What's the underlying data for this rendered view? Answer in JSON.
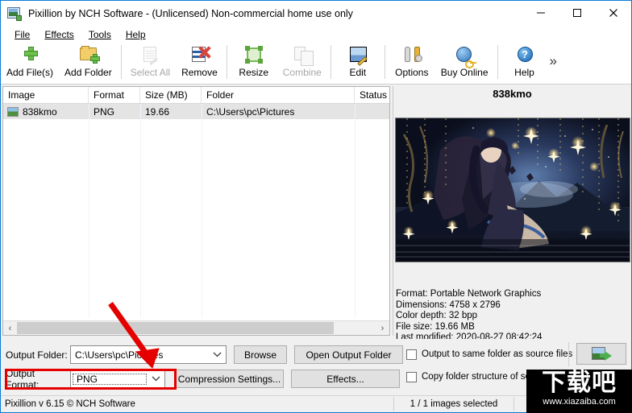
{
  "window": {
    "title": "Pixillion by NCH Software - (Unlicensed) Non-commercial home use only",
    "app_icon": "image-app-icon",
    "minimize": "–",
    "maximize": "□",
    "close": "✕"
  },
  "menu": [
    {
      "label": "File"
    },
    {
      "label": "Effects"
    },
    {
      "label": "Tools"
    },
    {
      "label": "Help"
    }
  ],
  "toolbar": {
    "items": [
      {
        "label": "Add File(s)",
        "icon": "green-plus-icon",
        "enabled": true
      },
      {
        "label": "Add Folder",
        "icon": "folder-plus-icon",
        "enabled": true
      },
      {
        "label": "Select All",
        "icon": "select-all-icon",
        "enabled": false
      },
      {
        "label": "Remove",
        "icon": "remove-red-x-icon",
        "enabled": true
      },
      {
        "label": "Resize",
        "icon": "resize-icon",
        "enabled": true
      },
      {
        "label": "Combine",
        "icon": "combine-icon",
        "enabled": false
      },
      {
        "label": "Edit",
        "icon": "edit-image-icon",
        "enabled": true
      },
      {
        "label": "Options",
        "icon": "wrench-screwdriver-icon",
        "enabled": true
      },
      {
        "label": "Buy Online",
        "icon": "globe-key-icon",
        "enabled": true
      },
      {
        "label": "Help",
        "icon": "help-question-icon",
        "enabled": true
      }
    ],
    "overflow": "»"
  },
  "file_list": {
    "columns": [
      "Image",
      "Format",
      "Size (MB)",
      "Folder",
      "Status"
    ],
    "rows": [
      {
        "image": "838kmo",
        "format": "PNG",
        "size": "19.66",
        "folder": "C:\\Users\\pc\\Pictures",
        "status": ""
      }
    ],
    "scroll_left_arrow": "‹",
    "scroll_right_arrow": "›"
  },
  "preview": {
    "title": "838kmo",
    "metadata": [
      "Format: Portable Network Graphics",
      "Dimensions: 4758 x 2796",
      "Color depth: 32 bpp",
      "File size: 19.66 MB",
      "Last modified: 2020-08-27 08:42:24"
    ]
  },
  "output": {
    "folder_label": "Output Folder:",
    "folder_value": "C:\\Users\\pc\\Pictures",
    "browse_button": "Browse",
    "open_output_button": "Open Output Folder",
    "format_label": "Output Format:",
    "format_value": "PNG",
    "compression_button": "Compression Settings...",
    "effects_button": "Effects...",
    "checkbox_same_folder": "Output to same folder as source files",
    "checkbox_copy_structure": "Copy folder structure of source files",
    "convert_button_icon": "convert-image-icon"
  },
  "statusbar": {
    "left": "Pixillion v 6.15 © NCH Software",
    "selection": "1 / 1 images selected"
  },
  "watermark": {
    "text": "下载吧",
    "url": "www.xiazaiba.com"
  },
  "annotations": {
    "arrow_color": "#e50000",
    "highlight_color": "#e50000"
  }
}
